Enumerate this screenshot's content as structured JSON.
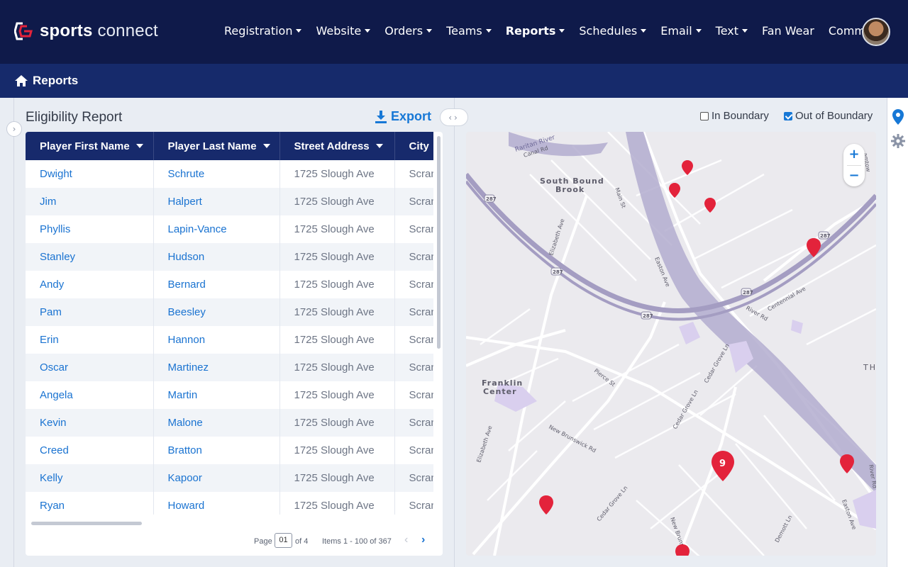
{
  "app": {
    "brand_bold": "sports",
    "brand_light": "connect"
  },
  "nav": [
    {
      "label": "Registration",
      "has_menu": true,
      "active": false
    },
    {
      "label": "Website",
      "has_menu": true,
      "active": false
    },
    {
      "label": "Orders",
      "has_menu": true,
      "active": false
    },
    {
      "label": "Teams",
      "has_menu": true,
      "active": false
    },
    {
      "label": "Reports",
      "has_menu": true,
      "active": true
    },
    {
      "label": "Schedules",
      "has_menu": true,
      "active": false
    },
    {
      "label": "Email",
      "has_menu": true,
      "active": false
    },
    {
      "label": "Text",
      "has_menu": true,
      "active": false
    },
    {
      "label": "Fan Wear",
      "has_menu": false,
      "active": false
    },
    {
      "label": "Common",
      "has_menu": true,
      "active": false
    }
  ],
  "breadcrumb": {
    "title": "Reports"
  },
  "report": {
    "title": "Eligibility Report",
    "export_label": "Export",
    "columns": [
      "Player First Name",
      "Player Last Name",
      "Street Address",
      "City"
    ],
    "rows": [
      [
        "Dwight",
        "Schrute",
        "1725 Slough Ave",
        "Scranton"
      ],
      [
        "Jim",
        "Halpert",
        "1725 Slough Ave",
        "Scranton"
      ],
      [
        "Phyllis",
        "Lapin-Vance",
        "1725 Slough Ave",
        "Scranton"
      ],
      [
        "Stanley",
        "Hudson",
        "1725 Slough Ave",
        "Scranton"
      ],
      [
        "Andy",
        "Bernard",
        "1725 Slough Ave",
        "Scranton"
      ],
      [
        "Pam",
        "Beesley",
        "1725 Slough Ave",
        "Scranton"
      ],
      [
        "Erin",
        "Hannon",
        "1725 Slough Ave",
        "Scranton"
      ],
      [
        "Oscar",
        "Martinez",
        "1725 Slough Ave",
        "Scranton"
      ],
      [
        "Angela",
        "Martin",
        "1725 Slough Ave",
        "Scranton"
      ],
      [
        "Kevin",
        "Malone",
        "1725 Slough Ave",
        "Scranton"
      ],
      [
        "Creed",
        "Bratton",
        "1725 Slough Ave",
        "Scranton"
      ],
      [
        "Kelly",
        "Kapoor",
        "1725 Slough Ave",
        "Scranton"
      ],
      [
        "Ryan",
        "Howard",
        "1725 Slough Ave",
        "Scranton"
      ]
    ]
  },
  "pager": {
    "page_label": "Page",
    "page_value": "01",
    "of_label": "of 4",
    "items_label": "Items 1 - 100 of 367"
  },
  "filters": {
    "in_boundary": {
      "label": "In Boundary",
      "checked": false
    },
    "out_of_boundary": {
      "label": "Out of Boundary",
      "checked": true
    }
  },
  "map": {
    "zoom_in": "+",
    "zoom_out": "−",
    "cluster_count": "9",
    "labels": {
      "raritan_river": "Raritan River",
      "canal_rd": "Canal Rd",
      "south_bound_brook": "South Bound Brook",
      "main_st": "Main St",
      "elizabeth_ave": "Elizabeth Ave",
      "easton_ave": "Easton Ave",
      "centennial_ave": "Centennial Ave",
      "river_rd": "River Rd",
      "franklin_center": "Franklin Center",
      "pierce_st": "Pierce St",
      "cedar_grove_ln": "Cedar Grove Ln",
      "new_brunswick_rd": "New Brunswick Rd",
      "demott_ln": "Demott Ln",
      "hwy_287": "287",
      "edge_th": "TH",
      "edge_river": "River Rd",
      "edge_hamtow": "amtow"
    },
    "marker_color": "#e3233b"
  },
  "colors": {
    "nav_bg": "#0f1a4a",
    "accent": "#1778d6",
    "header_bg": "#172a6c"
  }
}
